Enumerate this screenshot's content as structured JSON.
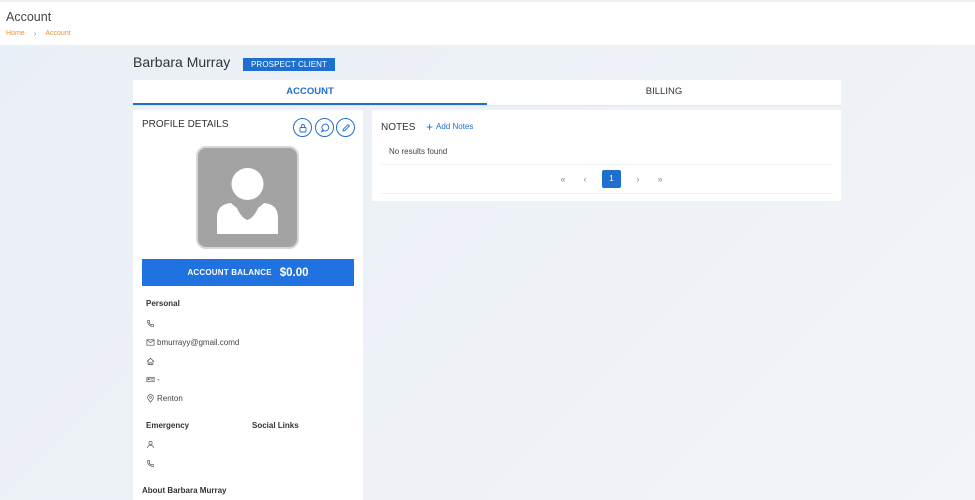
{
  "header": {
    "title": "Account",
    "breadcrumb": [
      "Home",
      "Account"
    ]
  },
  "client": {
    "name": "Barbara Murray",
    "status_badge": "PROSPECT CLIENT"
  },
  "tabs": [
    {
      "label": "ACCOUNT",
      "active": true
    },
    {
      "label": "BILLING",
      "active": false
    }
  ],
  "profile": {
    "title": "PROFILE DETAILS",
    "actions": [
      "lock-icon",
      "chat-icon",
      "edit-icon"
    ],
    "balance_label": "ACCOUNT BALANCE",
    "balance_value": "$0.00",
    "personal_label": "Personal",
    "personal": {
      "phone": "",
      "email": "bmurrayy@gmail.comd",
      "home": "",
      "id": "-",
      "location": "Renton"
    },
    "emergency_label": "Emergency",
    "social_label": "Social Links",
    "about_label": "About Barbara Murray"
  },
  "notes": {
    "title": "NOTES",
    "add_label": "Add Notes",
    "empty_text": "No results found",
    "pagination": {
      "first": "«",
      "prev": "‹",
      "current": "1",
      "next": "›",
      "last": "»"
    }
  },
  "colors": {
    "accent": "#1e6fcf",
    "breadcrumb": "#f0922b",
    "balance_bg": "#1f72e0"
  }
}
